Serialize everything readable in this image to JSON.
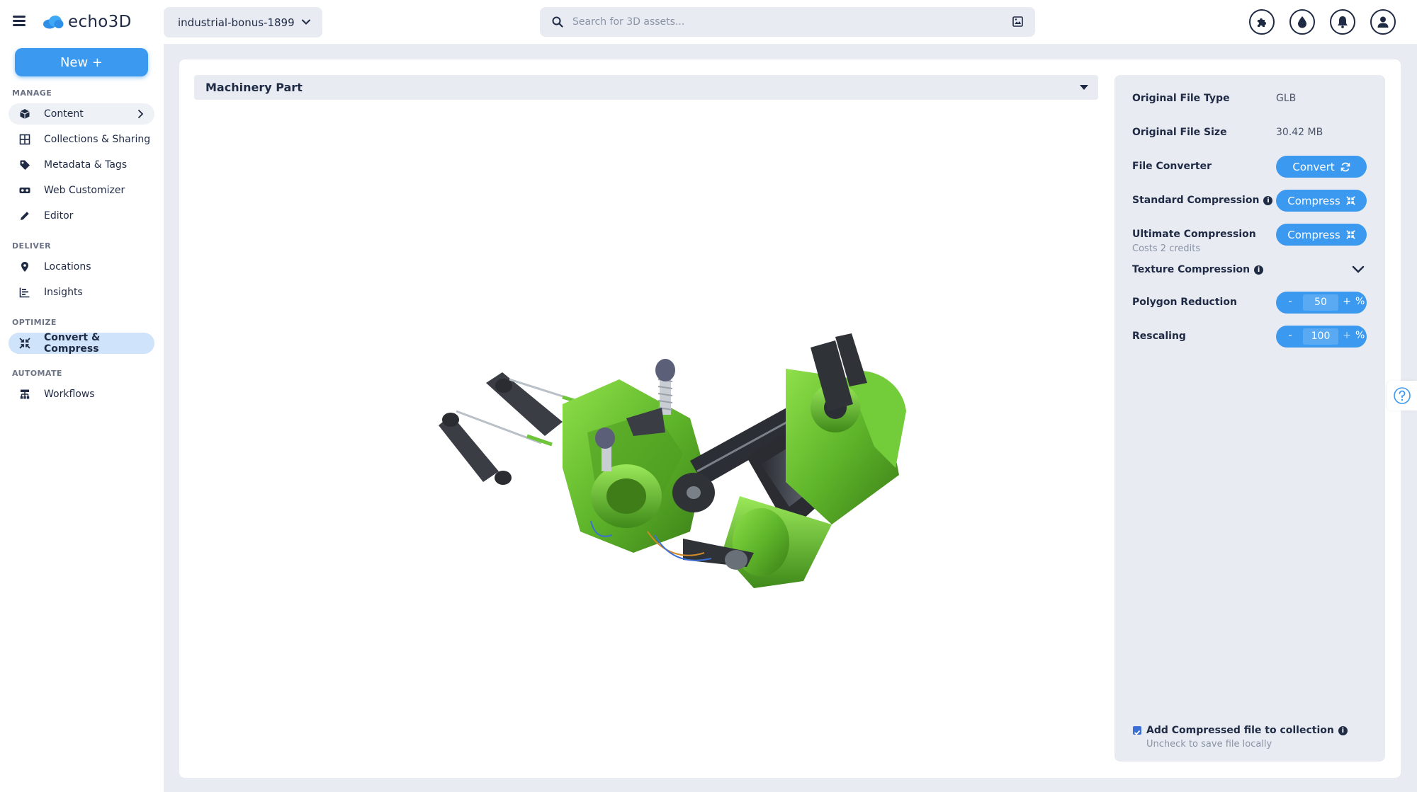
{
  "brand": {
    "name": "echo3D"
  },
  "project": {
    "name": "industrial-bonus-1899"
  },
  "search": {
    "placeholder": "Search for 3D assets..."
  },
  "top_icons": [
    "puzzle-icon",
    "drop-icon",
    "bell-icon",
    "user-icon"
  ],
  "sidebar": {
    "new_label": "New +",
    "sections": [
      {
        "label": "MANAGE",
        "items": [
          {
            "label": "Content",
            "icon": "cube-icon"
          },
          {
            "label": "Collections & Sharing",
            "icon": "grid-icon"
          },
          {
            "label": "Metadata & Tags",
            "icon": "tag-icon"
          },
          {
            "label": "Web Customizer",
            "icon": "vr-icon"
          },
          {
            "label": "Editor",
            "icon": "pencil-icon"
          }
        ]
      },
      {
        "label": "DELIVER",
        "items": [
          {
            "label": "Locations",
            "icon": "pin-icon"
          },
          {
            "label": "Insights",
            "icon": "chart-icon"
          }
        ]
      },
      {
        "label": "OPTIMIZE",
        "items": [
          {
            "label": "Convert & Compress",
            "icon": "compress-icon"
          }
        ]
      },
      {
        "label": "AUTOMATE",
        "items": [
          {
            "label": "Workflows",
            "icon": "workflow-icon"
          }
        ]
      }
    ]
  },
  "asset": {
    "title": "Machinery Part"
  },
  "panel": {
    "file_type_label": "Original File Type",
    "file_type_value": "GLB",
    "file_size_label": "Original File Size",
    "file_size_value": "30.42 MB",
    "converter_label": "File Converter",
    "convert_btn": "Convert",
    "std_comp_label": "Standard Compression",
    "compress_btn": "Compress",
    "ult_comp_label": "Ultimate Compression",
    "ult_comp_note": "Costs 2 credits",
    "texture_label": "Texture Compression",
    "polygon_label": "Polygon Reduction",
    "polygon_value": "50",
    "rescale_label": "Rescaling",
    "rescale_value": "100",
    "minus": "-",
    "plus": "+",
    "percent": "%",
    "add_label": "Add Compressed file to collection",
    "add_note": "Uncheck to save file locally",
    "info_glyph": "i"
  },
  "colors": {
    "accent": "#3b99f0",
    "bg": "#e8ebf2",
    "text": "#1f2a44",
    "active_nav": "#cfe3fb",
    "model_green": "#5fb62a"
  }
}
